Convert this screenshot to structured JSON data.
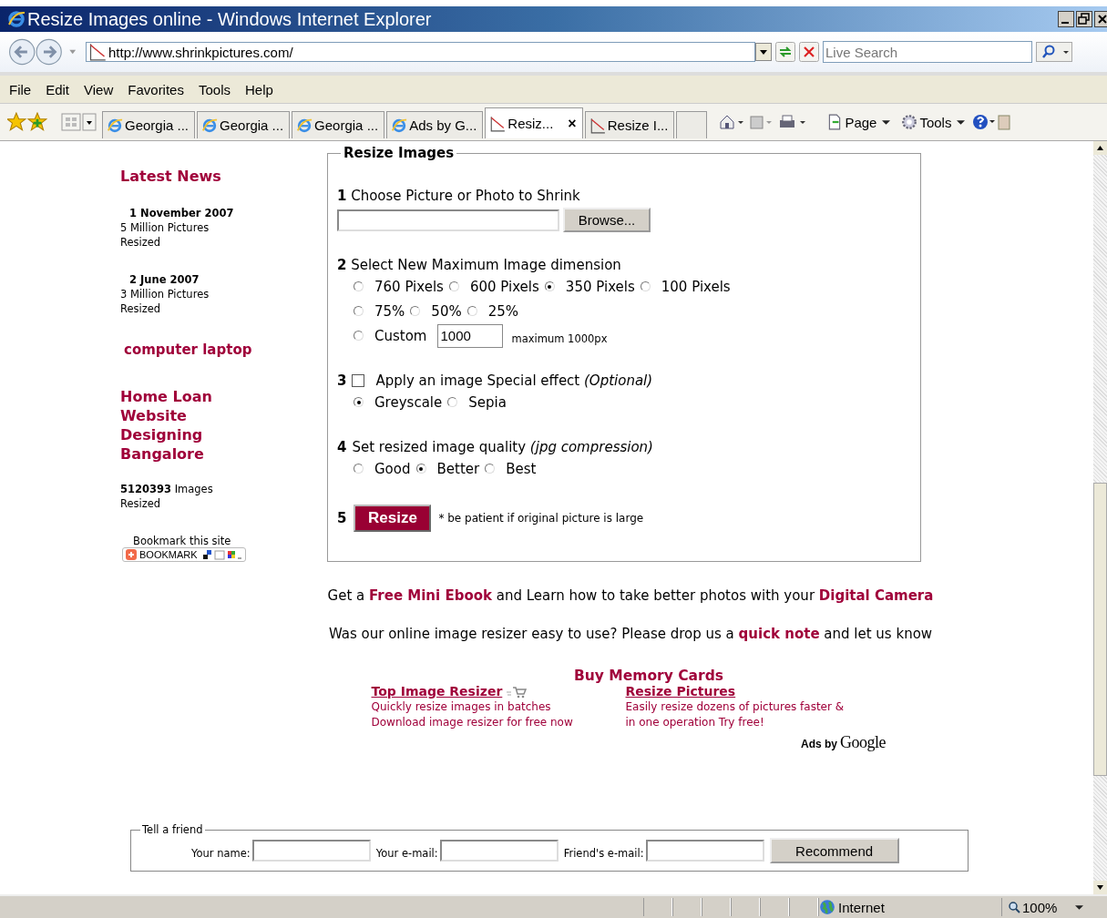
{
  "window": {
    "title": "Resize Images online - Windows Internet Explorer"
  },
  "address": {
    "url": "http://www.shrinkpictures.com/",
    "search_placeholder": "Live Search"
  },
  "menu": [
    "File",
    "Edit",
    "View",
    "Favorites",
    "Tools",
    "Help"
  ],
  "tabs": [
    {
      "label": "Georgia ...",
      "kind": "ie",
      "selected": false
    },
    {
      "label": "Georgia ...",
      "kind": "ie",
      "selected": false
    },
    {
      "label": "Georgia ...",
      "kind": "ie",
      "selected": false
    },
    {
      "label": "Ads by G...",
      "kind": "ie",
      "selected": false
    },
    {
      "label": "Resiz...",
      "kind": "page",
      "selected": true,
      "close": "×"
    },
    {
      "label": "Resize I...",
      "kind": "page",
      "selected": false
    },
    {
      "kind": "new",
      "selected": false
    }
  ],
  "command_bar": [
    "Page",
    "Tools"
  ],
  "sidebar": {
    "heading": "Latest News",
    "news": [
      {
        "date": "1 November 2007",
        "text": "5 Million Pictures Resized"
      },
      {
        "date": "2 June 2007",
        "text": "3 Million Pictures Resized"
      }
    ],
    "link_small": "computer laptop",
    "link_large": "Home Loan Website Designing Bangalore",
    "counter": "**5120393** Images Resized",
    "bookmark_caption": "Bookmark this site",
    "bookmark_button": "BOOKMARK"
  },
  "form": {
    "legend": "Resize Images",
    "step1": {
      "number": "1",
      "label": "Choose Picture or Photo to Shrink",
      "browse": "Browse..."
    },
    "step2": {
      "number": "2",
      "label": "Select New Maximum Image dimension",
      "rows": [
        {
          "options": [
            {
              "label": "760 Pixels",
              "selected": false
            },
            {
              "label": "600 Pixels",
              "selected": false
            },
            {
              "label": "350 Pixels",
              "selected": true
            },
            {
              "label": "100 Pixels",
              "selected": false
            }
          ]
        },
        {
          "options": [
            {
              "label": "75%",
              "selected": false
            },
            {
              "label": "50%",
              "selected": false
            },
            {
              "label": "25%",
              "selected": false
            }
          ]
        }
      ],
      "custom": {
        "label": "Custom",
        "selected": false,
        "value": "1000",
        "hint": "maximum 1000px"
      }
    },
    "step3": {
      "number": "3",
      "checked": false,
      "label": "Apply an image Special effect *(Optional)*",
      "options": [
        {
          "label": "Greyscale",
          "selected": true
        },
        {
          "label": "Sepia",
          "selected": false
        }
      ]
    },
    "step4": {
      "number": "4",
      "label": "Set resized image quality *(jpg compression)*",
      "options": [
        {
          "label": "Good",
          "selected": false
        },
        {
          "label": "Better",
          "selected": true
        },
        {
          "label": "Best",
          "selected": false
        }
      ]
    },
    "step5": {
      "number": "5",
      "button": "Resize",
      "note": "* be patient if original picture is large"
    }
  },
  "promos": [
    [
      {
        "text": "Get a ",
        "link": false
      },
      {
        "text": "Free Mini Ebook",
        "link": true
      },
      {
        "text": " and Learn how to take better photos with your ",
        "link": false
      },
      {
        "text": "Digital Camera",
        "link": true
      }
    ],
    [
      {
        "text": "Was our online image resizer easy to use? Please drop us a ",
        "link": false
      },
      {
        "text": "quick note",
        "link": true
      },
      {
        "text": " and let us know",
        "link": false
      }
    ]
  ],
  "ads": {
    "heading": "Buy Memory Cards",
    "items": [
      {
        "title": "Top Image Resizer",
        "lines": [
          "Quickly resize images in batches",
          "Download image resizer for free now"
        ]
      },
      {
        "title": "Resize Pictures",
        "lines": [
          "Easily resize dozens of pictures faster &",
          "in one operation Try free!"
        ]
      }
    ],
    "by": "Ads by",
    "brand": "Google"
  },
  "tell_friend": {
    "legend": "Tell a friend",
    "fields": [
      "Your name:",
      "Your e-mail:",
      "Friend's e-mail:"
    ],
    "button": "Recommend"
  },
  "status_bar": {
    "zone": "Internet",
    "zoom": "100%"
  }
}
